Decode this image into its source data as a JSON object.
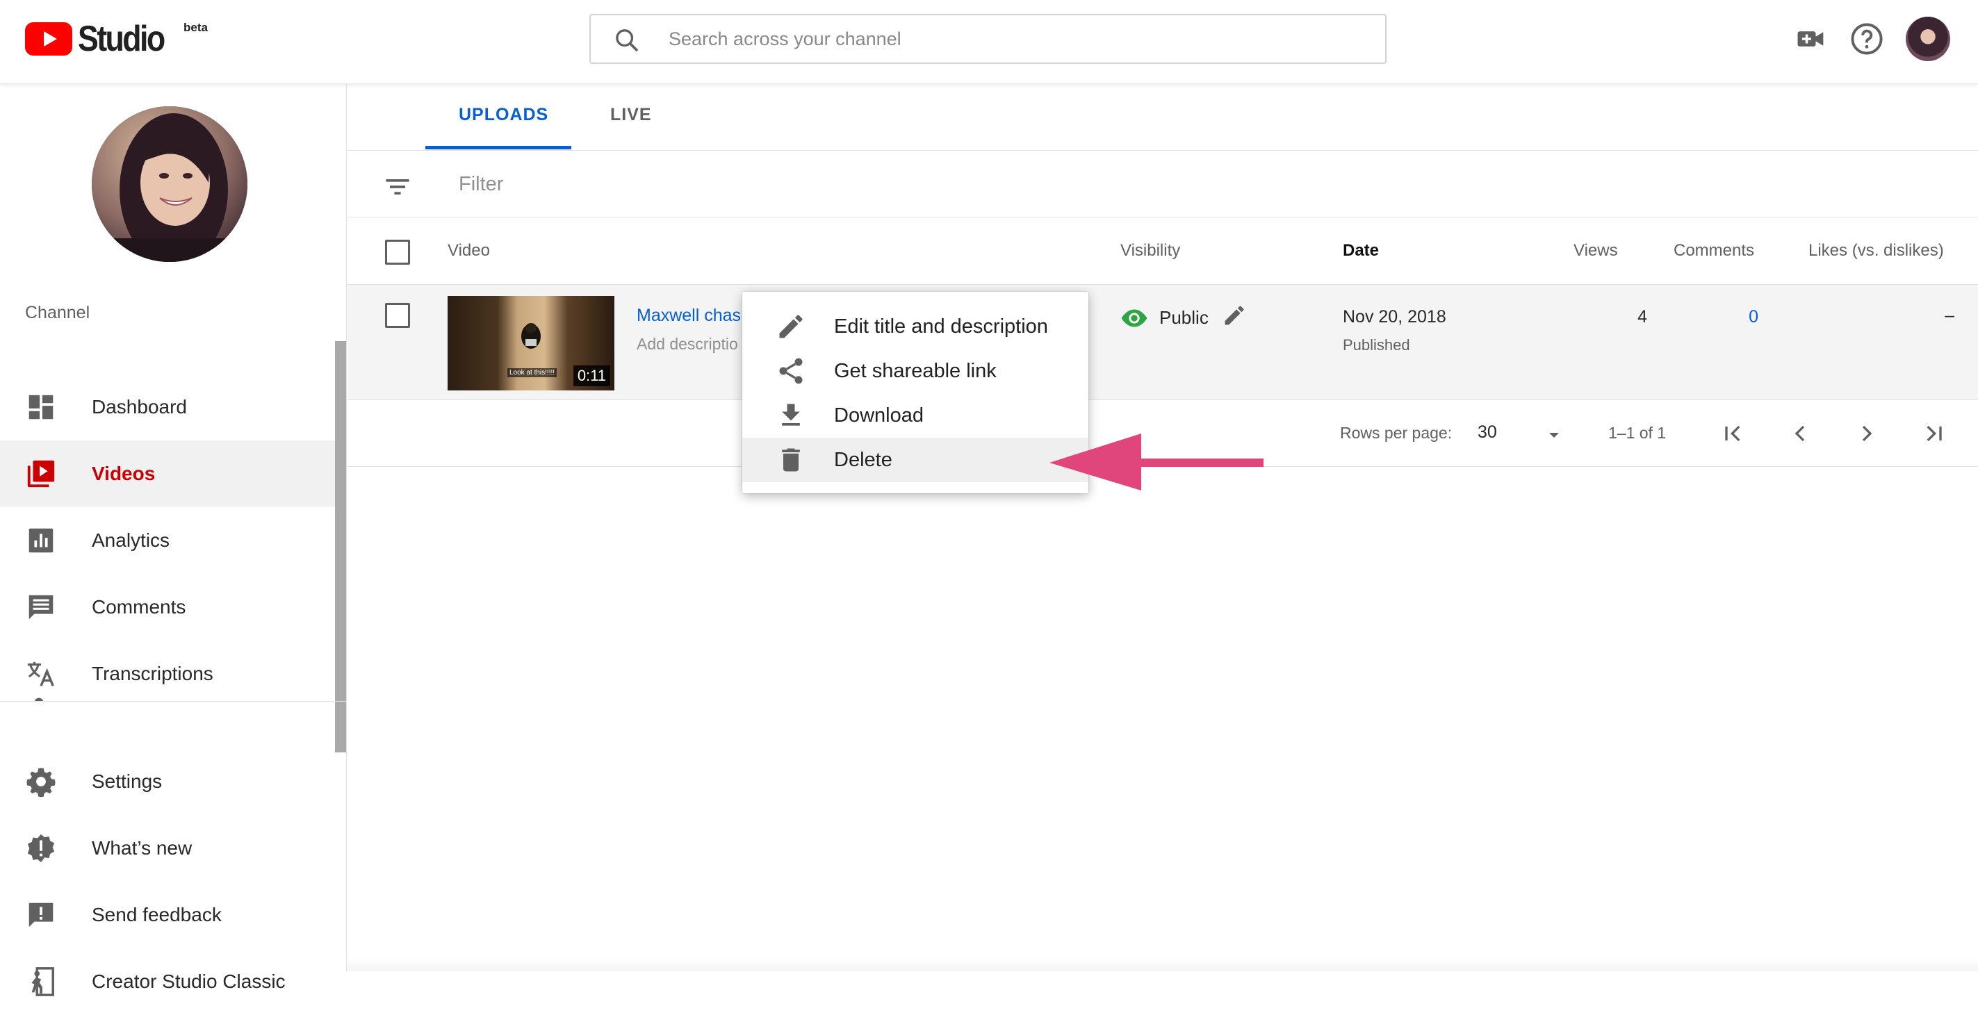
{
  "header": {
    "logo_text": "Studio",
    "logo_badge": "beta",
    "search_placeholder": "Search across your channel"
  },
  "sidebar": {
    "section_label": "Channel",
    "items": [
      {
        "label": "Dashboard",
        "icon": "dashboard-icon"
      },
      {
        "label": "Videos",
        "icon": "videos-icon",
        "active": true
      },
      {
        "label": "Analytics",
        "icon": "analytics-icon"
      },
      {
        "label": "Comments",
        "icon": "comments-icon"
      },
      {
        "label": "Transcriptions",
        "icon": "transcriptions-icon"
      }
    ],
    "bottom_items": [
      {
        "label": "Settings",
        "icon": "gear-icon"
      },
      {
        "label": "What’s new",
        "icon": "whats-new-icon"
      },
      {
        "label": "Send feedback",
        "icon": "feedback-icon"
      },
      {
        "label": "Creator Studio Classic",
        "icon": "classic-icon"
      }
    ]
  },
  "tabs": [
    {
      "label": "UPLOADS",
      "active": true
    },
    {
      "label": "LIVE",
      "active": false
    }
  ],
  "filter": {
    "placeholder": "Filter"
  },
  "table": {
    "columns": [
      "Video",
      "Visibility",
      "Date",
      "Views",
      "Comments",
      "Likes (vs. dislikes)"
    ],
    "rows": [
      {
        "title": "Maxwell chas",
        "description": "Add descriptio",
        "duration": "0:11",
        "thumbnail_caption": "Look at this!!!!!",
        "visibility": "Public",
        "date": "Nov 20, 2018",
        "status": "Published",
        "views": "4",
        "comments": "0",
        "likes": "–"
      }
    ]
  },
  "pagination": {
    "rows_label": "Rows per page:",
    "rows_value": "30",
    "range": "1–1 of 1"
  },
  "context_menu": {
    "items": [
      {
        "label": "Edit title and description",
        "icon": "pencil-icon"
      },
      {
        "label": "Get shareable link",
        "icon": "share-icon"
      },
      {
        "label": "Download",
        "icon": "download-icon"
      },
      {
        "label": "Delete",
        "icon": "trash-icon",
        "highlighted": true
      }
    ]
  },
  "colors": {
    "accent_blue": "#065fd4",
    "brand_red": "#ff0000",
    "active_nav_red": "#cc0000",
    "visibility_green": "#2ba640",
    "annotation_pink": "#e0457b"
  }
}
